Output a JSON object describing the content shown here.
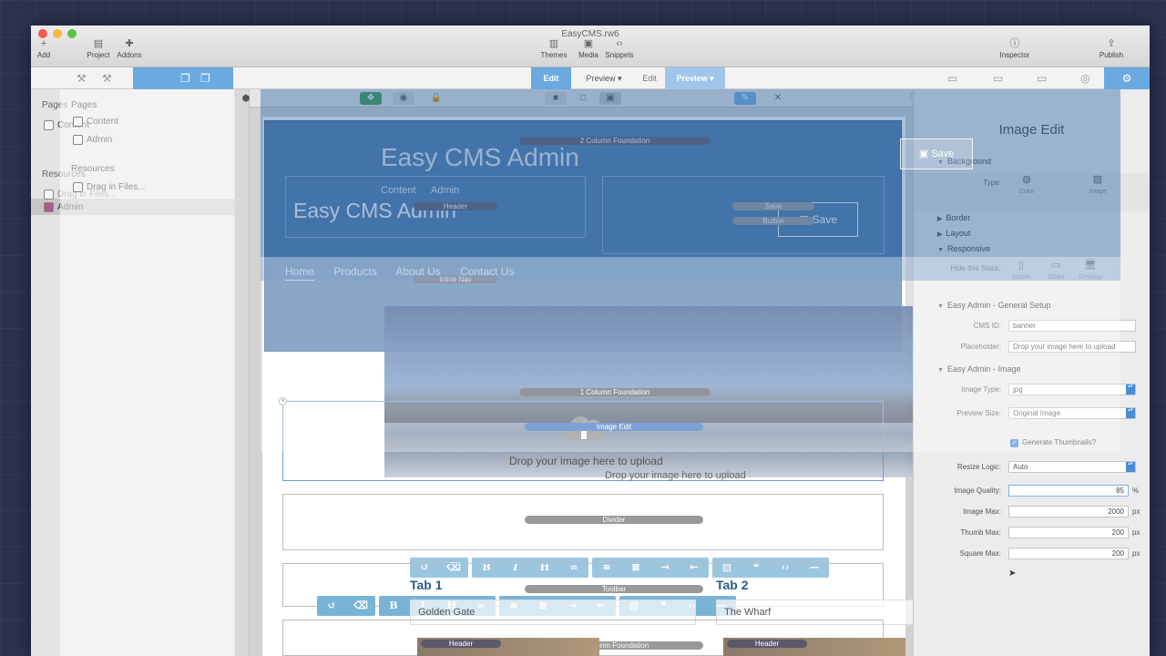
{
  "window": {
    "title": "EasyCMS.rw6"
  },
  "toolbar": {
    "add": "Add",
    "project": "Project",
    "addons": "Addons",
    "themes": "Themes",
    "media": "Media",
    "snippets": "Snippets",
    "inspector": "Inspector",
    "publish": "Publish"
  },
  "modes": {
    "edit": "Edit",
    "preview": "Preview",
    "edit2": "Edit",
    "preview2": "Preview"
  },
  "sidebar": {
    "pages_label": "Pages",
    "pages": [
      "Content",
      "Admin"
    ],
    "resources_label": "Resources",
    "drag_files": "Drag in Files..."
  },
  "canvas": {
    "stack_labels": {
      "two_col": "2 Column Foundation",
      "header": "Header",
      "save": "Save",
      "button": "Button",
      "inline_nav": "Inline Nav",
      "one_col": "1 Column Foundation",
      "image_edit": "Image Edit",
      "divider": "Divider",
      "toolbar": "Toolbar",
      "two_col_2": "2 Column Foundation",
      "header_a": "Header",
      "header_b": "Header"
    },
    "hero_title": "Easy CMS Admin",
    "hero_links": [
      "Content",
      "Admin"
    ],
    "hero_title2": "Easy CMS Admin",
    "save_button": "Save",
    "nav": [
      "Home",
      "Products",
      "About Us",
      "Contact Us"
    ],
    "drop_text": "Drop your image here to upload",
    "drop_text2": "Drop your image here to upload",
    "tabs": [
      "Tab 1",
      "Tab 2"
    ],
    "rows": [
      "Golden Gate",
      "The Wharf"
    ]
  },
  "inspector": {
    "title": "Image Edit",
    "ghost_save": "Save",
    "sections": {
      "background": "Background",
      "border": "Border",
      "layout": "Layout",
      "responsive": "Responsive",
      "general": "Easy Admin - General Setup",
      "image": "Easy Admin - Image"
    },
    "type_label": "Type:",
    "type_options": [
      "Color",
      "Image"
    ],
    "hide_label": "Hide this Stack:",
    "hide_options": [
      "Mobile",
      "Tablet",
      "Desktop"
    ],
    "cms_id_label": "CMS ID:",
    "cms_id": "banner",
    "placeholder_label": "Placeholder:",
    "placeholder": "Drop your image here to upload",
    "image_type_label": "Image Type:",
    "image_type": "jpg",
    "preview_size_label": "Preview Size:",
    "preview_size": "Original Image",
    "thumbs_label": "Generate Thumbnails?",
    "resize_label": "Resize Logic:",
    "resize": "Auto",
    "quality_label": "Image Quality:",
    "quality": "85",
    "quality_unit": "%",
    "max_label": "Image Max:",
    "max": "2000",
    "thumb_label": "Thumb Max:",
    "thumb": "200",
    "square_label": "Square Max:",
    "square": "200",
    "px": "px"
  }
}
